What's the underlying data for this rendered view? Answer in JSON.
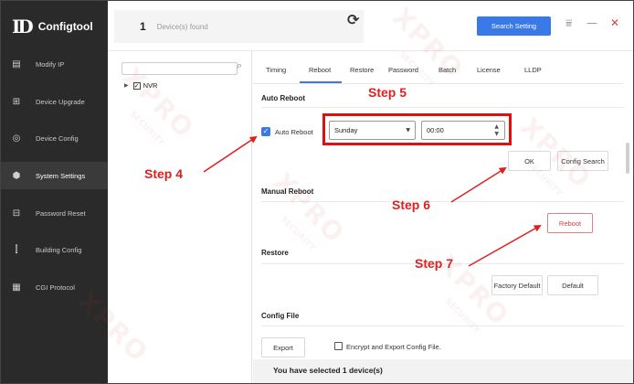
{
  "app": {
    "logo_mark": "ID",
    "title": "Configtool"
  },
  "sidebar": {
    "items": [
      {
        "label": "Modify IP",
        "icon": "modify-ip-icon",
        "glyph": "▤"
      },
      {
        "label": "Device Upgrade",
        "icon": "device-upgrade-icon",
        "glyph": "⊞"
      },
      {
        "label": "Device Config",
        "icon": "device-config-icon",
        "glyph": "◎"
      },
      {
        "label": "System Settings",
        "icon": "system-settings-icon",
        "glyph": "⬢"
      },
      {
        "label": "Password Reset",
        "icon": "password-reset-icon",
        "glyph": "⊟"
      },
      {
        "label": "Building Config",
        "icon": "building-config-icon",
        "glyph": "⫿"
      },
      {
        "label": "CGI Protocol",
        "icon": "cgi-protocol-icon",
        "glyph": "▦"
      }
    ],
    "active_index": 3
  },
  "topbar": {
    "device_count": "1",
    "device_label": "Device(s) found",
    "refresh_glyph": "⟳",
    "search_setting": "Search Setting",
    "filter_glyph": "⩸",
    "minimize_glyph": "—",
    "close_glyph": "✕"
  },
  "tree": {
    "search_glyph": "⌕",
    "node_arrow": "▶",
    "node_check": "✓",
    "node_label": "NVR"
  },
  "tabs": [
    "Timing",
    "Reboot",
    "Restore",
    "Password",
    "Batch",
    "License",
    "LLDP"
  ],
  "active_tab": "Reboot",
  "auto_reboot": {
    "section": "Auto Reboot",
    "check_glyph": "✓",
    "check_label": "Auto Reboot",
    "day": "Sunday",
    "day_arrow": "▼",
    "time": "00:00",
    "spin_up": "▲",
    "spin_down": "▼",
    "ok": "OK",
    "config_search": "Config Search"
  },
  "manual_reboot": {
    "section": "Manual Reboot",
    "reboot": "Reboot"
  },
  "restore": {
    "section": "Restore",
    "factory_default": "Factory Default",
    "default": "Default"
  },
  "config_file": {
    "section": "Config File",
    "export": "Export",
    "encrypt_label": "Encrypt and Export Config File."
  },
  "status": {
    "selected": "You have selected 1 device(s)"
  },
  "watermark": {
    "brand": "XPRO",
    "sub": "SECURITY"
  },
  "annotations": {
    "step4": "Step 4",
    "step5": "Step 5",
    "step6": "Step 6",
    "step7": "Step 7",
    "color": "#e02020"
  }
}
